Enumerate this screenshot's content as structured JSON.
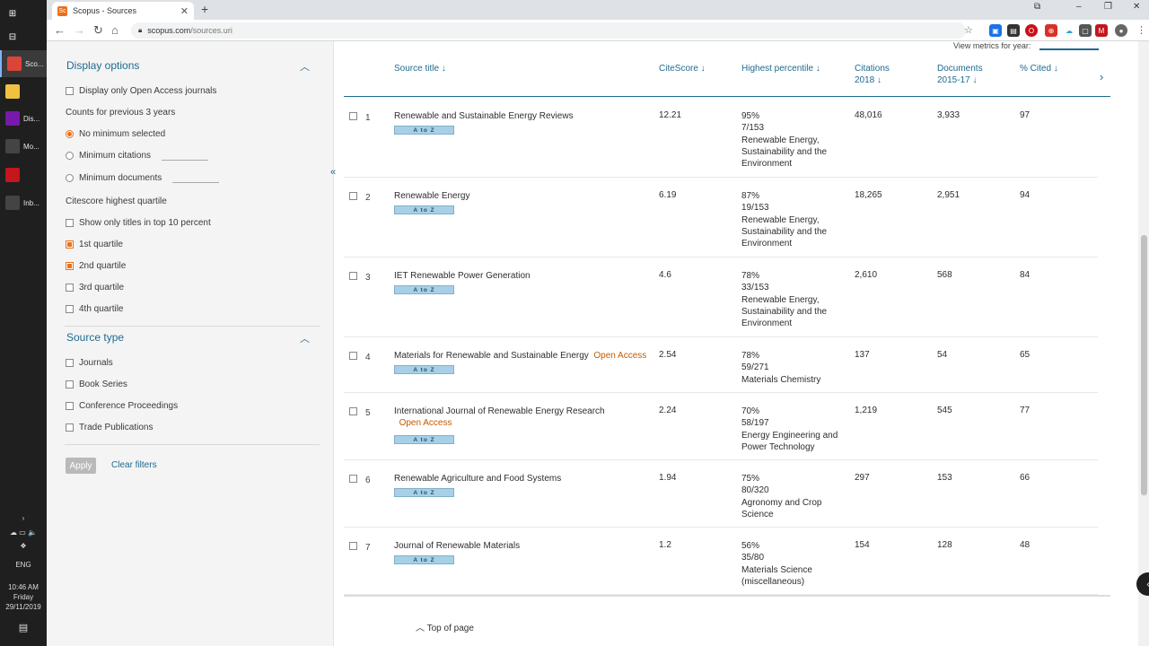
{
  "taskbar": {
    "apps": [
      {
        "label": "Sco...",
        "icon": "chrome-icon",
        "color": "#db4437"
      },
      {
        "label": "",
        "icon": "file-explorer-icon",
        "color": "#f0c040"
      },
      {
        "label": "Dis...",
        "icon": "onenote-icon",
        "color": "#7719aa"
      },
      {
        "label": "Mo...",
        "icon": "calendar-icon",
        "color": "#444"
      },
      {
        "label": "",
        "icon": "mendeley-icon",
        "color": "#c4161c"
      },
      {
        "label": "Inb...",
        "icon": "mail-icon",
        "color": "#444"
      }
    ],
    "lang": "ENG",
    "time": "10:46 AM",
    "day": "Friday",
    "date": "29/11/2019"
  },
  "browser": {
    "tab_title": "Scopus - Sources",
    "url_domain": "scopus.com",
    "url_path": "/sources.uri"
  },
  "sidebar": {
    "display_options_title": "Display options",
    "open_access_only": "Display only Open Access journals",
    "counts_label": "Counts for previous 3 years",
    "no_minimum": "No minimum selected",
    "minimum_citations": "Minimum citations",
    "minimum_documents": "Minimum documents",
    "quartile_label": "Citescore highest quartile",
    "top10": "Show only titles in top 10 percent",
    "q1": "1st quartile",
    "q2": "2nd quartile",
    "q3": "3rd quartile",
    "q4": "4th quartile",
    "source_type_title": "Source type",
    "journals": "Journals",
    "book_series": "Book Series",
    "conference": "Conference Proceedings",
    "trade": "Trade Publications",
    "apply": "Apply",
    "clear": "Clear filters"
  },
  "table": {
    "year_label": "View metrics for year:",
    "headers": {
      "source_title": "Source title ↓",
      "citescore": "CiteScore ↓",
      "percentile": "Highest percentile ↓",
      "citations_1": "Citations",
      "citations_2": "2018 ↓",
      "documents_1": "Documents",
      "documents_2": "2015-17 ↓",
      "cited": "% Cited ↓"
    },
    "atoz": "A to Z",
    "rows": [
      {
        "num": "1",
        "title": "Renewable and Sustainable Energy Reviews",
        "oa": "",
        "citescore": "12.21",
        "pct": "95%",
        "rank": "7/153",
        "category": "Renewable Energy, Sustainability and the Environment",
        "citations": "48,016",
        "documents": "3,933",
        "cited": "97"
      },
      {
        "num": "2",
        "title": "Renewable Energy",
        "oa": "",
        "citescore": "6.19",
        "pct": "87%",
        "rank": "19/153",
        "category": "Renewable Energy, Sustainability and the Environment",
        "citations": "18,265",
        "documents": "2,951",
        "cited": "94"
      },
      {
        "num": "3",
        "title": "IET Renewable Power Generation",
        "oa": "",
        "citescore": "4.6",
        "pct": "78%",
        "rank": "33/153",
        "category": "Renewable Energy, Sustainability and the Environment",
        "citations": "2,610",
        "documents": "568",
        "cited": "84"
      },
      {
        "num": "4",
        "title": "Materials for Renewable and Sustainable Energy",
        "oa": "Open Access",
        "citescore": "2.54",
        "pct": "78%",
        "rank": "59/271",
        "category": "Materials Chemistry",
        "citations": "137",
        "documents": "54",
        "cited": "65"
      },
      {
        "num": "5",
        "title": "International Journal of Renewable Energy Research",
        "oa": "Open Access",
        "citescore": "2.24",
        "pct": "70%",
        "rank": "58/197",
        "category": "Energy Engineering and Power Technology",
        "citations": "1,219",
        "documents": "545",
        "cited": "77"
      },
      {
        "num": "6",
        "title": "Renewable Agriculture and Food Systems",
        "oa": "",
        "citescore": "1.94",
        "pct": "75%",
        "rank": "80/320",
        "category": "Agronomy and Crop Science",
        "citations": "297",
        "documents": "153",
        "cited": "66"
      },
      {
        "num": "7",
        "title": "Journal of Renewable Materials",
        "oa": "",
        "citescore": "1.2",
        "pct": "56%",
        "rank": "35/80",
        "category": "Materials Science (miscellaneous)",
        "citations": "154",
        "documents": "128",
        "cited": "48"
      }
    ],
    "top_of_page": "Top of page"
  }
}
